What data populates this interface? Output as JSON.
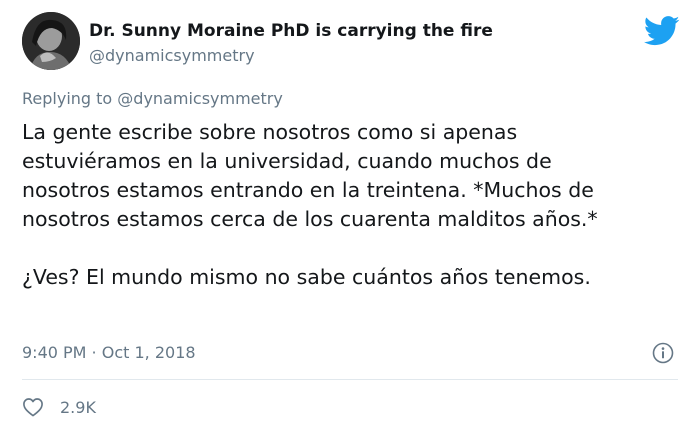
{
  "tweet": {
    "author_name": "Dr. Sunny Moraine PhD is carrying the fire",
    "author_handle": "@dynamicsymmetry",
    "replying_to": "Replying to @dynamicsymmetry",
    "body_lines": [
      "La gente escribe sobre nosotros como si apenas",
      "estuviéramos en la universidad, cuando muchos de",
      "nosotros estamos entrando en la treintena. *Muchos de",
      "nosotros estamos cerca de los cuarenta malditos años.*"
    ],
    "body_paragraph_2": "¿Ves? El mundo mismo no sabe cuántos años tenemos.",
    "timestamp": "9:40 PM · Oct 1, 2018",
    "likes": "2.9K"
  },
  "icons": {
    "brand": "twitter-bird-icon",
    "info": "info-icon",
    "like": "heart-icon"
  },
  "colors": {
    "brand": "#1da1f2",
    "text_primary": "#14171a",
    "text_secondary": "#657786",
    "divider": "#e1e8ed"
  }
}
